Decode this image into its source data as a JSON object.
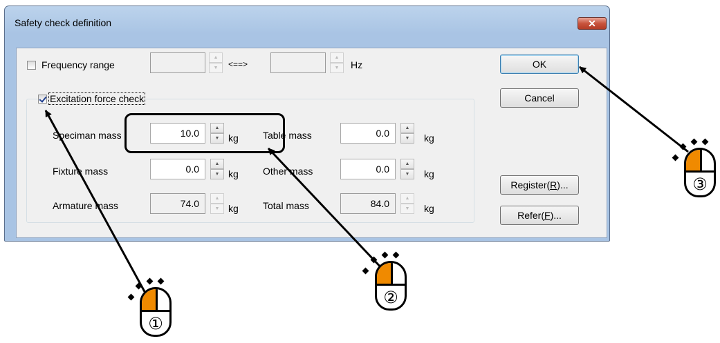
{
  "dialog": {
    "title": "Safety check definition",
    "close_glyph": "✕"
  },
  "frequency": {
    "checkbox_label": "Frequency range",
    "checked": false,
    "separator": "<==>",
    "unit": "Hz",
    "from_value": "",
    "to_value": ""
  },
  "excitation": {
    "checkbox_label": "Excitation force check",
    "checked": true
  },
  "masses": {
    "speciman": {
      "label": "Speciman mass",
      "value": "10.0",
      "unit": "kg"
    },
    "table": {
      "label": "Table mass",
      "value": "0.0",
      "unit": "kg"
    },
    "fixture": {
      "label": "Fixture  mass",
      "value": "0.0",
      "unit": "kg"
    },
    "other": {
      "label": "Other mass",
      "value": "0.0",
      "unit": "kg"
    },
    "armature": {
      "label": "Armature mass",
      "value": "74.0",
      "unit": "kg"
    },
    "total": {
      "label": "Total mass",
      "value": "84.0",
      "unit": "kg"
    }
  },
  "buttons": {
    "ok": "OK",
    "cancel": "Cancel",
    "register_prefix": "Register(",
    "register_key": "R",
    "register_suffix": ")...",
    "refer_prefix": "Refer(",
    "refer_key": "F",
    "refer_suffix": ")..."
  },
  "annotations": {
    "step1": "①",
    "step2": "②",
    "step3": "③"
  },
  "colors": {
    "mouse_button": "#f08a00",
    "arrow": "#000000",
    "close_button": "#c8543d"
  },
  "icons": [
    "close-icon",
    "spin-up-icon",
    "spin-down-icon",
    "mouse-icon",
    "checkmark-icon"
  ]
}
